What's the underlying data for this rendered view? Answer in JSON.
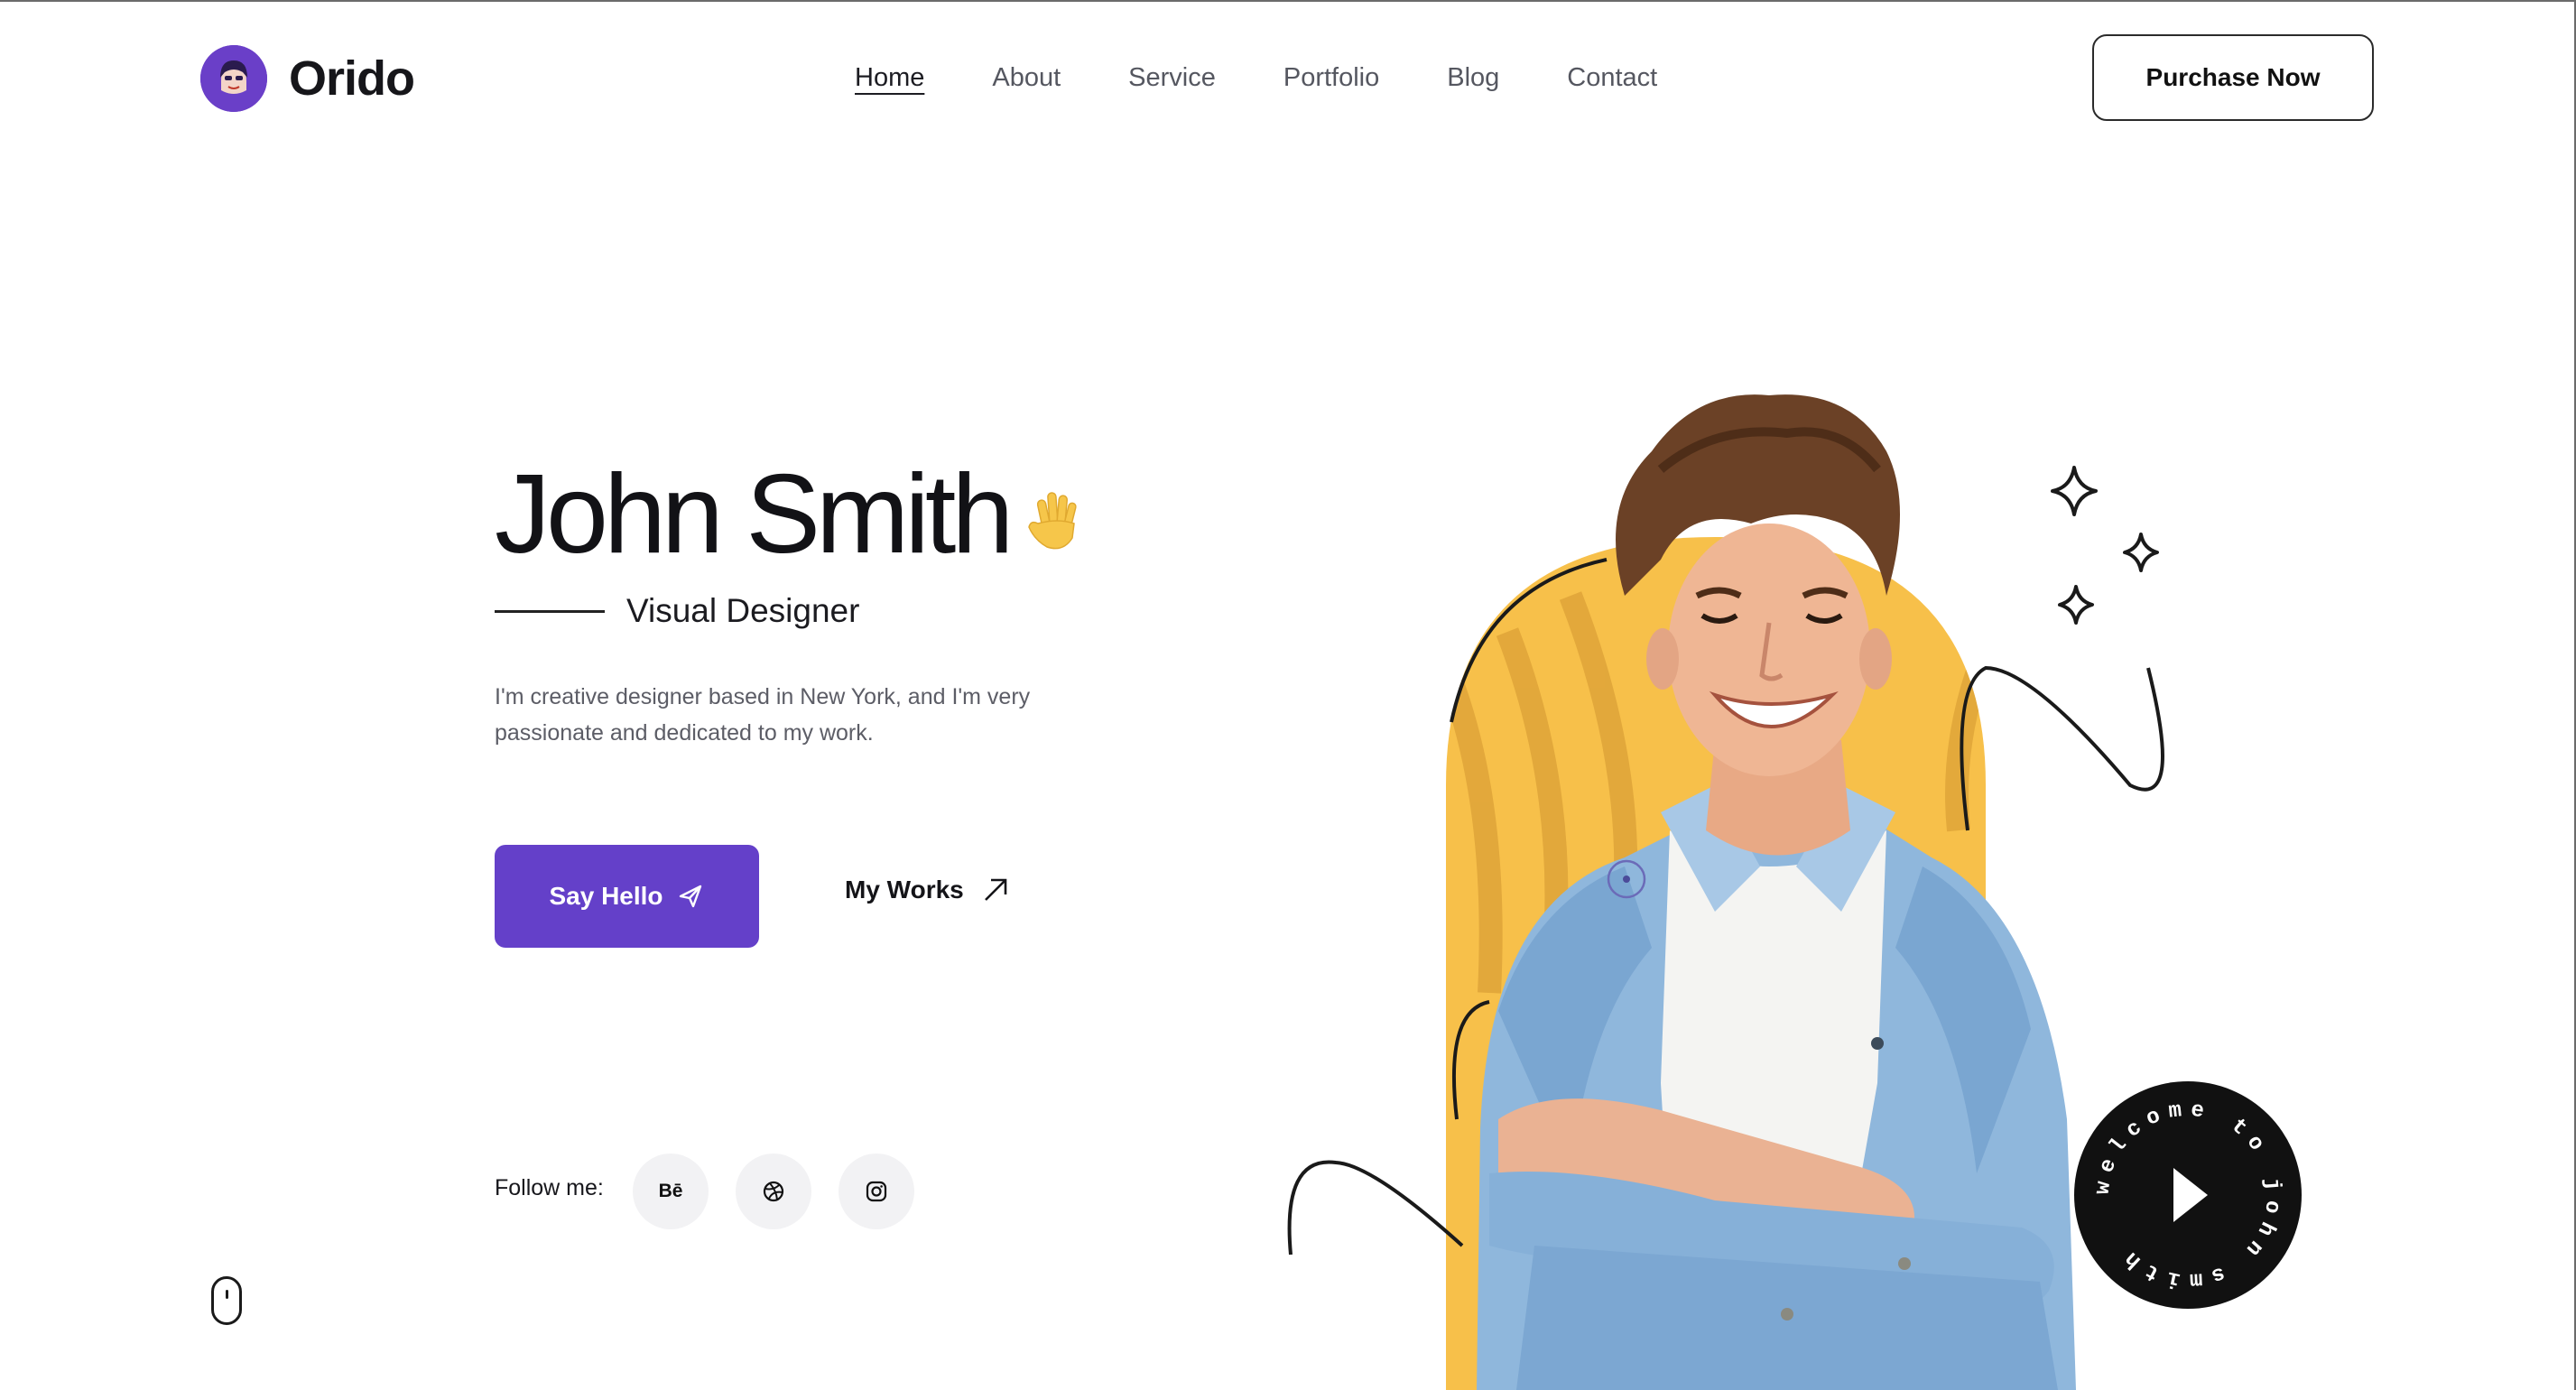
{
  "brand": {
    "name": "Orido",
    "accent": "#6440c9"
  },
  "nav": {
    "items": [
      {
        "label": "Home",
        "active": true
      },
      {
        "label": "About",
        "active": false
      },
      {
        "label": "Service",
        "active": false
      },
      {
        "label": "Portfolio",
        "active": false
      },
      {
        "label": "Blog",
        "active": false
      },
      {
        "label": "Contact",
        "active": false
      }
    ]
  },
  "header": {
    "purchase_label": "Purchase Now"
  },
  "hero": {
    "name": "John Smith",
    "role": "Visual Designer",
    "intro": "I'm creative designer based in New York, and I'm very passionate and dedicated to my work.",
    "primary_cta": "Say Hello",
    "secondary_cta": "My Works",
    "follow_label": "Follow me:",
    "welcome_badge_text": "welcome to john smith"
  },
  "socials": [
    {
      "name": "behance",
      "label": "Bē",
      "icon": "behance-icon"
    },
    {
      "name": "dribbble",
      "label": "",
      "icon": "dribbble-icon"
    },
    {
      "name": "instagram",
      "label": "",
      "icon": "instagram-icon"
    }
  ],
  "colors": {
    "arch": "#f7c04a",
    "arch_stripe": "#e2a93a",
    "badge": "#111111",
    "text_muted": "#5c5d66"
  }
}
